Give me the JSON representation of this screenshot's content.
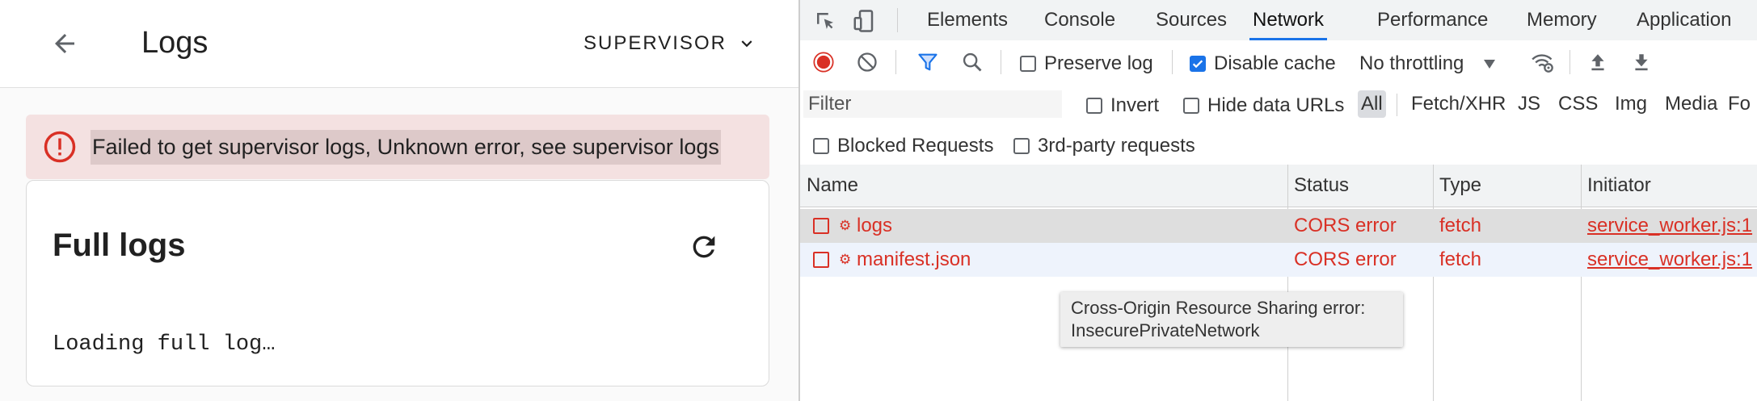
{
  "app": {
    "title": "Logs",
    "supervisor_select": "SUPERVISOR",
    "error_message": "Failed to get supervisor logs, Unknown error, see supervisor logs",
    "card_title": "Full logs",
    "loading_text": "Loading full log…"
  },
  "devtools": {
    "tabs": [
      {
        "label": "Elements",
        "active": false
      },
      {
        "label": "Console",
        "active": false
      },
      {
        "label": "Sources",
        "active": false
      },
      {
        "label": "Network",
        "active": true
      },
      {
        "label": "Performance",
        "active": false
      },
      {
        "label": "Memory",
        "active": false
      },
      {
        "label": "Application",
        "active": false
      }
    ],
    "toolbar": {
      "preserve_log": {
        "label": "Preserve log",
        "checked": false
      },
      "disable_cache": {
        "label": "Disable cache",
        "checked": true
      },
      "throttling": "No throttling"
    },
    "filter": {
      "placeholder": "Filter",
      "invert": {
        "label": "Invert",
        "checked": false
      },
      "hide_data_urls": {
        "label": "Hide data URLs",
        "checked": false
      },
      "types": [
        {
          "label": "All",
          "active": true
        },
        {
          "label": "Fetch/XHR",
          "active": false
        },
        {
          "label": "JS",
          "active": false
        },
        {
          "label": "CSS",
          "active": false
        },
        {
          "label": "Img",
          "active": false
        },
        {
          "label": "Media",
          "active": false
        },
        {
          "label": "Fo",
          "active": false
        }
      ]
    },
    "blocked_requests": {
      "label": "Blocked Requests",
      "checked": false
    },
    "third_party_requests": {
      "label": "3rd-party requests",
      "checked": false
    },
    "table": {
      "columns": [
        "Name",
        "Status",
        "Type",
        "Initiator"
      ],
      "rows": [
        {
          "name": "logs",
          "status": "CORS error",
          "type": "fetch",
          "initiator": "service_worker.js:1"
        },
        {
          "name": "manifest.json",
          "status": "CORS error",
          "type": "fetch",
          "initiator": "service_worker.js:1"
        }
      ]
    },
    "tooltip": {
      "line1": "Cross-Origin Resource Sharing error:",
      "line2": "InsecurePrivateNetwork"
    }
  },
  "colors": {
    "error": "#d93025",
    "accent": "#1a73e8",
    "alert_bg": "#f4e1e1",
    "record": "#d93025"
  }
}
